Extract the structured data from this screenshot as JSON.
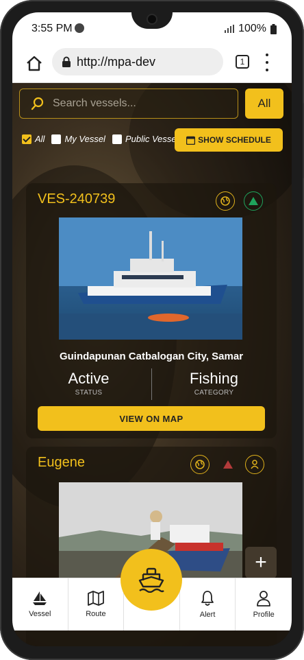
{
  "status_bar": {
    "time": "3:55 PM",
    "battery": "100%"
  },
  "browser": {
    "url": "http://mpa-dev",
    "tab_count": "1"
  },
  "search": {
    "placeholder": "Search vessels...",
    "filter_button": "All"
  },
  "filters": [
    {
      "label": "All",
      "checked": true
    },
    {
      "label": "My Vessel",
      "checked": false
    },
    {
      "label": "Public Vessel",
      "checked": false
    }
  ],
  "schedule_button": "SHOW SCHEDULE",
  "vessels": [
    {
      "id": "VES-240739",
      "location": "Guindapunan Catbalogan City, Samar",
      "status_value": "Active",
      "status_label": "STATUS",
      "category_value": "Fishing",
      "category_label": "CATEGORY",
      "action": "VIEW ON MAP"
    },
    {
      "id": "Eugene"
    }
  ],
  "fab_plus": "+",
  "nav": [
    {
      "label": "Vessel",
      "icon": "sailboat-icon"
    },
    {
      "label": "Route",
      "icon": "map-icon"
    },
    {
      "label": "",
      "icon": "ship-icon"
    },
    {
      "label": "Alert",
      "icon": "bell-icon"
    },
    {
      "label": "Profile",
      "icon": "person-icon"
    }
  ],
  "colors": {
    "accent": "#f2c01c",
    "green": "#1fa35c",
    "red": "#b23a3a"
  }
}
